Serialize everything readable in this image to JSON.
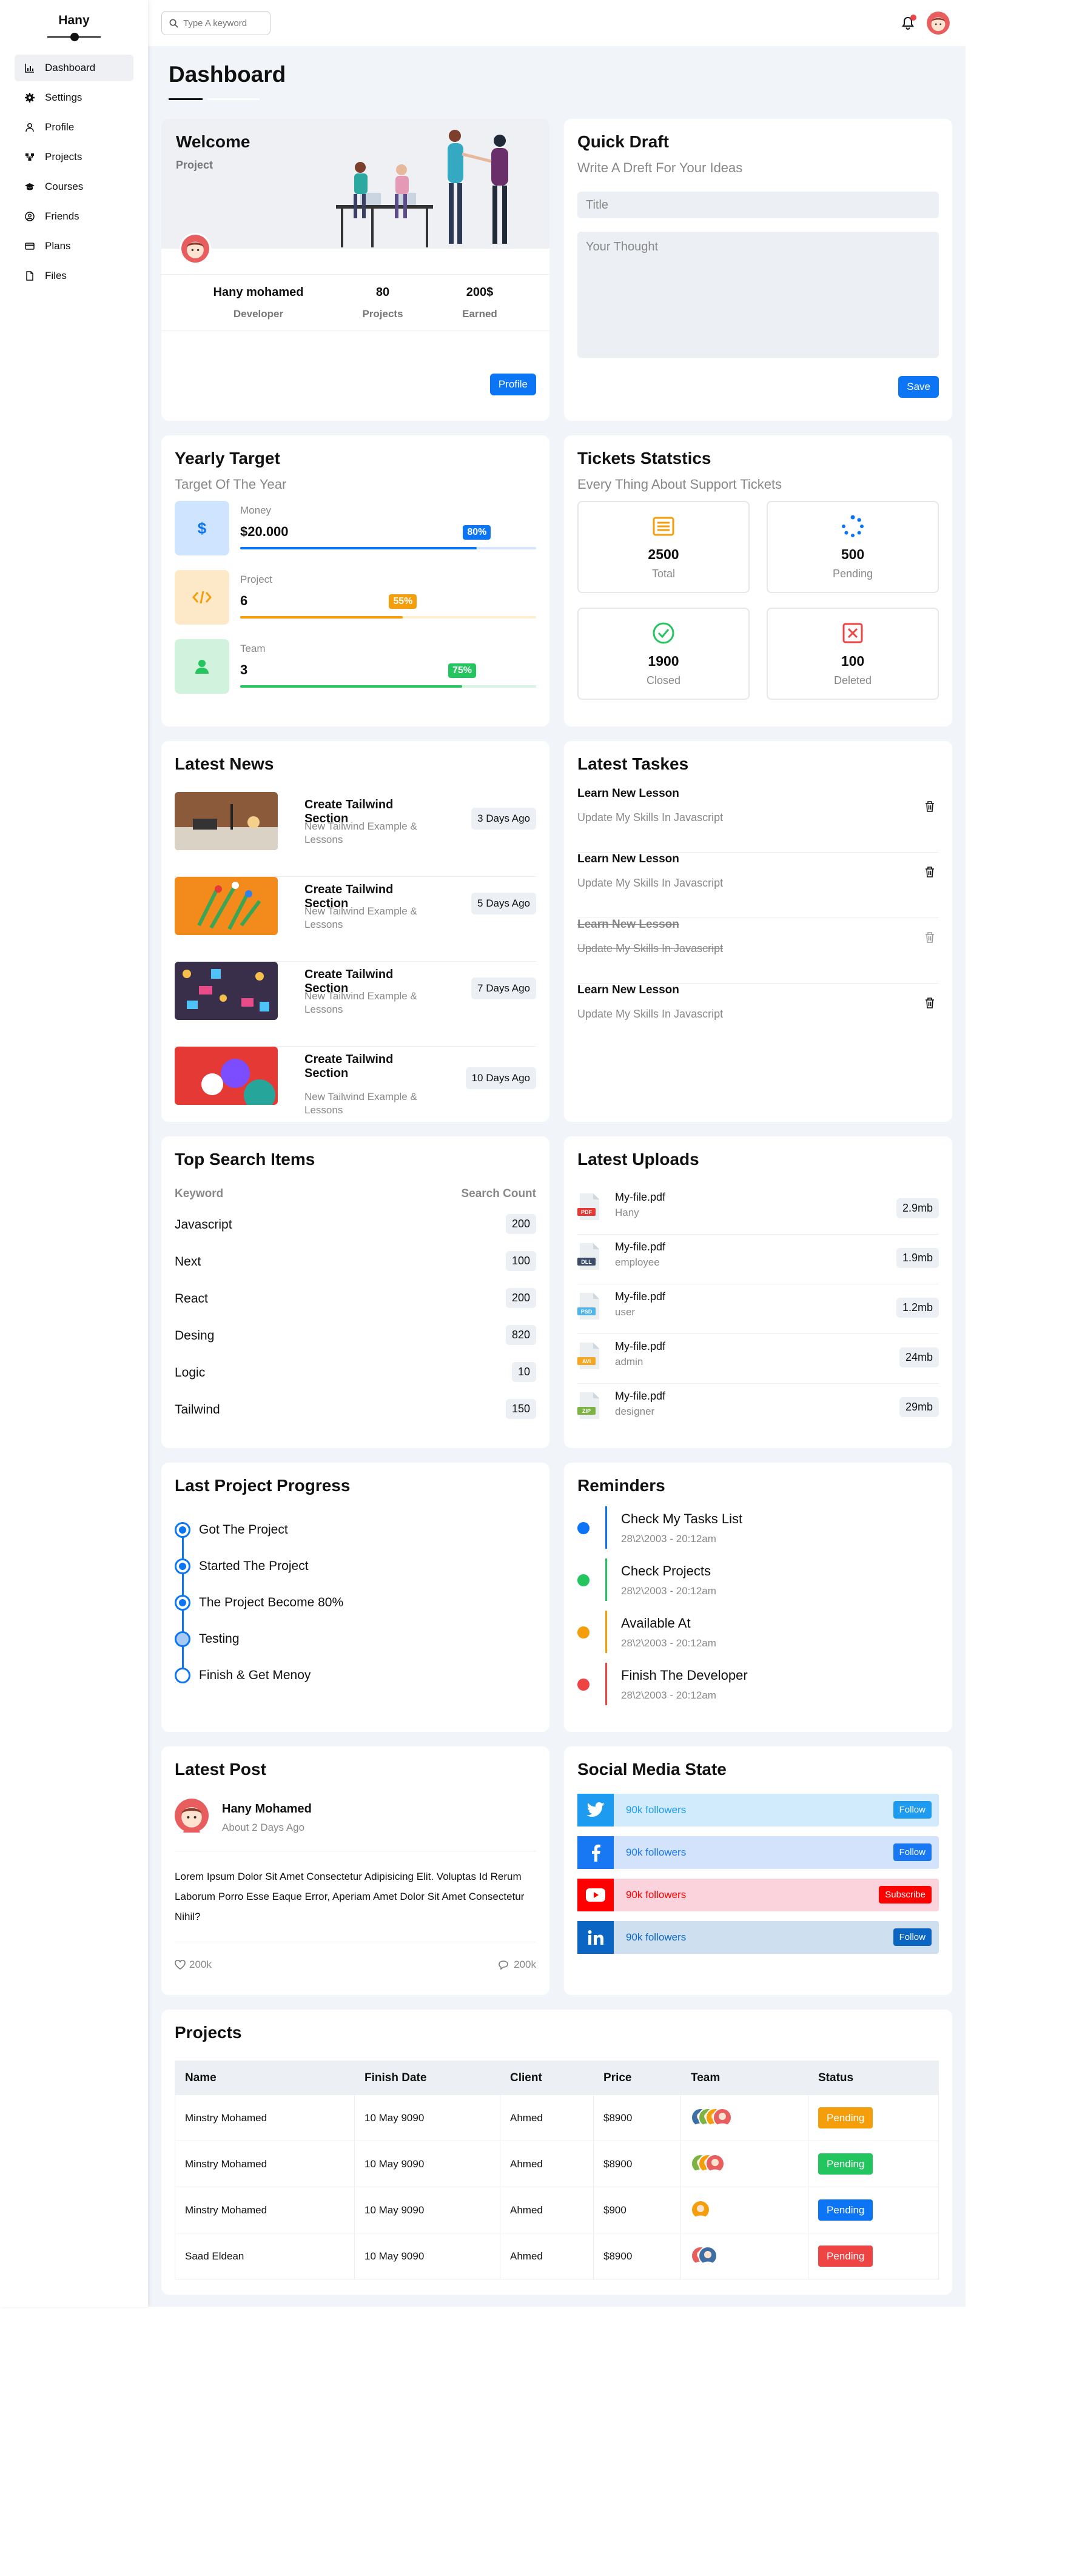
{
  "brand": "Hany",
  "sidebar": {
    "items": [
      {
        "label": "Dashboard",
        "icon": "chart-icon"
      },
      {
        "label": "Settings",
        "icon": "gear-icon"
      },
      {
        "label": "Profile",
        "icon": "user-icon"
      },
      {
        "label": "Projects",
        "icon": "projects-icon"
      },
      {
        "label": "Courses",
        "icon": "graduation-cap-icon"
      },
      {
        "label": "Friends",
        "icon": "friends-icon"
      },
      {
        "label": "Plans",
        "icon": "credit-card-icon"
      },
      {
        "label": "Files",
        "icon": "file-icon"
      }
    ]
  },
  "topbar": {
    "search_placeholder": "Type A keyword"
  },
  "page_title": "Dashboard",
  "welcome": {
    "title": "Welcome",
    "subtitle": "Project",
    "stats": [
      {
        "value": "Hany mohamed",
        "label": "Developer"
      },
      {
        "value": "80",
        "label": "Projects"
      },
      {
        "value": "200$",
        "label": "Earned"
      }
    ],
    "button": "Profile"
  },
  "quick_draft": {
    "title": "Quick Draft",
    "subtitle": "Write A Dreft For Your Ideas",
    "title_placeholder": "Title",
    "thought_placeholder": "Your Thought",
    "button": "Save"
  },
  "yearly_target": {
    "title": "Yearly Target",
    "subtitle": "Target Of The Year",
    "items": [
      {
        "label": "Money",
        "value": "$20.000",
        "percent": 80,
        "percent_label": "80%",
        "color": "#0c75f5",
        "icon": "dollar-icon",
        "bg": "#cfe4fe",
        "track": "#d6e6fb"
      },
      {
        "label": "Project",
        "value": "6",
        "percent": 55,
        "percent_label": "55%",
        "color": "#f59e0b",
        "icon": "code-icon",
        "bg": "#fde9c7",
        "track": "#fdf0d2"
      },
      {
        "label": "Team",
        "value": "3",
        "percent": 75,
        "percent_label": "75%",
        "color": "#22c55e",
        "icon": "team-icon",
        "bg": "#d1f2dd",
        "track": "#d8f3e2"
      }
    ]
  },
  "tickets": {
    "title": "Tickets Statstics",
    "subtitle": "Every Thing About Support Tickets",
    "items": [
      {
        "value": "2500",
        "label": "Total",
        "icon": "list-icon",
        "color": "#f59e0b"
      },
      {
        "value": "500",
        "label": "Pending",
        "icon": "spinner-icon",
        "color": "#0c75f5"
      },
      {
        "value": "1900",
        "label": "Closed",
        "icon": "check-circle-icon",
        "color": "#22c55e"
      },
      {
        "value": "100",
        "label": "Deleted",
        "icon": "x-square-icon",
        "color": "#ef4444"
      }
    ]
  },
  "news": {
    "title": "Latest News",
    "items": [
      {
        "title": "Create Tailwind Section",
        "desc": "New Tailwind Example & Lessons",
        "tag": "3 Days Ago"
      },
      {
        "title": "Create Tailwind Section",
        "desc": "New Tailwind Example & Lessons",
        "tag": "5 Days Ago"
      },
      {
        "title": "Create Tailwind Section",
        "desc": "New Tailwind Example & Lessons",
        "tag": "7 Days Ago"
      },
      {
        "title": "Create Tailwind Section",
        "desc": "New Tailwind Example & Lessons",
        "tag": "10 Days Ago"
      }
    ]
  },
  "tasks": {
    "title": "Latest Taskes",
    "items": [
      {
        "title": "Learn New Lesson",
        "desc": "Update My Skills In Javascript",
        "done": false
      },
      {
        "title": "Learn New Lesson",
        "desc": "Update My Skills In Javascript",
        "done": false
      },
      {
        "title": "Learn New Lesson",
        "desc": "Update My Skills In Javascript",
        "done": true
      },
      {
        "title": "Learn New Lesson",
        "desc": "Update My Skills In Javascript",
        "done": false
      }
    ]
  },
  "search_items": {
    "title": "Top Search Items",
    "col_keyword": "Keyword",
    "col_count": "Search Count",
    "rows": [
      {
        "keyword": "Javascript",
        "count": "200"
      },
      {
        "keyword": "Next",
        "count": "100"
      },
      {
        "keyword": "React",
        "count": "200"
      },
      {
        "keyword": "Desing",
        "count": "820"
      },
      {
        "keyword": "Logic",
        "count": "10"
      },
      {
        "keyword": "Tailwind",
        "count": "150"
      }
    ]
  },
  "uploads": {
    "title": "Latest Uploads",
    "items": [
      {
        "name": "My-file.pdf",
        "by": "Hany",
        "size": "2.9mb",
        "type": "PDF",
        "color": "#e53935"
      },
      {
        "name": "My-file.pdf",
        "by": "employee",
        "size": "1.9mb",
        "type": "DLL",
        "color": "#3d4b6b"
      },
      {
        "name": "My-file.pdf",
        "by": "user",
        "size": "1.2mb",
        "type": "PSD",
        "color": "#4fb3e8"
      },
      {
        "name": "My-file.pdf",
        "by": "admin",
        "size": "24mb",
        "type": "AVI",
        "color": "#f5a623"
      },
      {
        "name": "My-file.pdf",
        "by": "designer",
        "size": "29mb",
        "type": "ZIP",
        "color": "#7cb342"
      }
    ]
  },
  "progress": {
    "title": "Last Project Progress",
    "steps": [
      {
        "label": "Got The Project",
        "state": "done"
      },
      {
        "label": "Started The Project",
        "state": "done"
      },
      {
        "label": "The Project Become 80%",
        "state": "done"
      },
      {
        "label": "Testing",
        "state": "current"
      },
      {
        "label": "Finish & Get Menoy",
        "state": "todo"
      }
    ]
  },
  "reminders": {
    "title": "Reminders",
    "items": [
      {
        "title": "Check My Tasks List",
        "date": "28\\2\\2003 - 20:12am",
        "color": "#0c75f5"
      },
      {
        "title": "Check Projects",
        "date": "28\\2\\2003 - 20:12am",
        "color": "#22c55e"
      },
      {
        "title": "Available At",
        "date": "28\\2\\2003 - 20:12am",
        "color": "#f59e0b"
      },
      {
        "title": "Finish The Developer",
        "date": "28\\2\\2003 - 20:12am",
        "color": "#ef4444"
      }
    ]
  },
  "post": {
    "title": "Latest Post",
    "author": "Hany Mohamed",
    "time": "About 2 Days Ago",
    "body": "Lorem Ipsum Dolor Sit Amet Consectetur Adipisicing Elit. Voluptas Id Rerum Laborum Porro Esse Eaque Error, Aperiam Amet Dolor Sit Amet Consectetur Nihil?",
    "likes": "200k",
    "comments": "200k"
  },
  "social": {
    "title": "Social Media State",
    "items": [
      {
        "network": "twitter-icon",
        "followers": "90k followers",
        "button": "Follow",
        "color": "#1d9bf0",
        "bg": "#d2ebfc"
      },
      {
        "network": "facebook-icon",
        "followers": "90k followers",
        "button": "Follow",
        "color": "#1877f2",
        "bg": "#d3e3fb"
      },
      {
        "network": "youtube-icon",
        "followers": "90k followers",
        "button": "Subscribe",
        "color": "#ff0000",
        "bg": "#fbd3dc"
      },
      {
        "network": "linkedin-icon",
        "followers": "90k followers",
        "button": "Follow",
        "color": "#0a66c2",
        "bg": "#cee0ef"
      }
    ]
  },
  "projects": {
    "title": "Projects",
    "headers": [
      "Name",
      "Finish Date",
      "Client",
      "Price",
      "Team",
      "Status"
    ],
    "rows": [
      {
        "name": "Minstry Mohamed",
        "date": "10 May 9090",
        "client": "Ahmed",
        "price": "$8900",
        "team": 4,
        "status": "Pending",
        "status_color": "#f59e0b"
      },
      {
        "name": "Minstry Mohamed",
        "date": "10 May 9090",
        "client": "Ahmed",
        "price": "$8900",
        "team": 3,
        "status": "Pending",
        "status_color": "#22c55e"
      },
      {
        "name": "Minstry Mohamed",
        "date": "10 May 9090",
        "client": "Ahmed",
        "price": "$900",
        "team": 1,
        "status": "Pending",
        "status_color": "#0c75f5"
      },
      {
        "name": "Saad Eldean",
        "date": "10 May 9090",
        "client": "Ahmed",
        "price": "$8900",
        "team": 2,
        "status": "Pending",
        "status_color": "#ef4444"
      }
    ]
  }
}
